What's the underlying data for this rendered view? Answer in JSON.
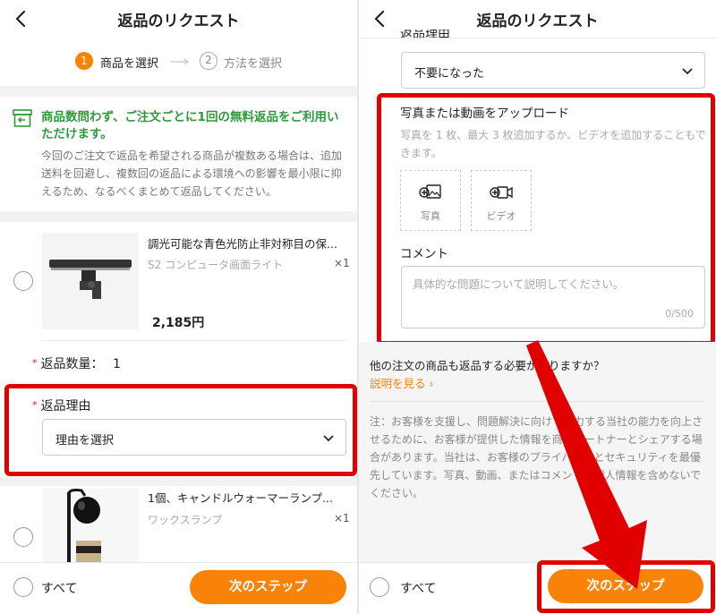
{
  "title": "返品のリクエスト",
  "stepper": {
    "step1_num": "1",
    "step1_label": "商品を選択",
    "step2_num": "2",
    "step2_label": "方法を選択"
  },
  "promo": {
    "title": "商品数問わず、ご注文ごとに1回の無料返品をご利用いただけます。",
    "body": "今回のご注文で返品を希望される商品が複数ある場合は、追加送料を回避し、複数回の返品による環境への影響を最小限に抑えるため、なるべくまとめて返品してください。"
  },
  "items": [
    {
      "title": "調光可能な青色光防止非対称目の保...",
      "variant": "S2 コンピュータ画面ライト",
      "qty": "×1",
      "price": "2,185円"
    },
    {
      "title": "1個、キャンドルウォーマーランプ...",
      "variant": "ワックスランプ",
      "qty": "×1"
    }
  ],
  "return_qty": {
    "label": "返品数量：",
    "value": "1"
  },
  "return_reason": {
    "label": "返品理由",
    "left_value": "理由を選択",
    "right_value": "不要になった"
  },
  "upload": {
    "title": "写真または動画をアップロード",
    "hint": "写真を 1 枚、最大 3 枚追加するか、ビデオを追加することもできます。",
    "photo_label": "写真",
    "video_label": "ビデオ"
  },
  "comment": {
    "label": "コメント",
    "placeholder": "具体的な問題について説明してください。",
    "counter": "0/500"
  },
  "other_items": {
    "question": "他の注文の商品も返品する必要がありますか？",
    "link": "説明を見る"
  },
  "notice": "注：お客様を支援し、問題解決に向けて努力する当社の能力を向上させるために、お客様が提供した情報を商品パートナーとシェアする場合があります。当社は、お客様のプライバシーとセキュリティを最優先しています。写真、動画、またはコメントに個人情報を含めないでください。",
  "bottom": {
    "select_all": "すべて",
    "next": "次のステップ"
  },
  "colors": {
    "accent": "#f98209",
    "promo_green": "#2e9a3a",
    "highlight_red": "#e00000",
    "link": "#f98209"
  }
}
